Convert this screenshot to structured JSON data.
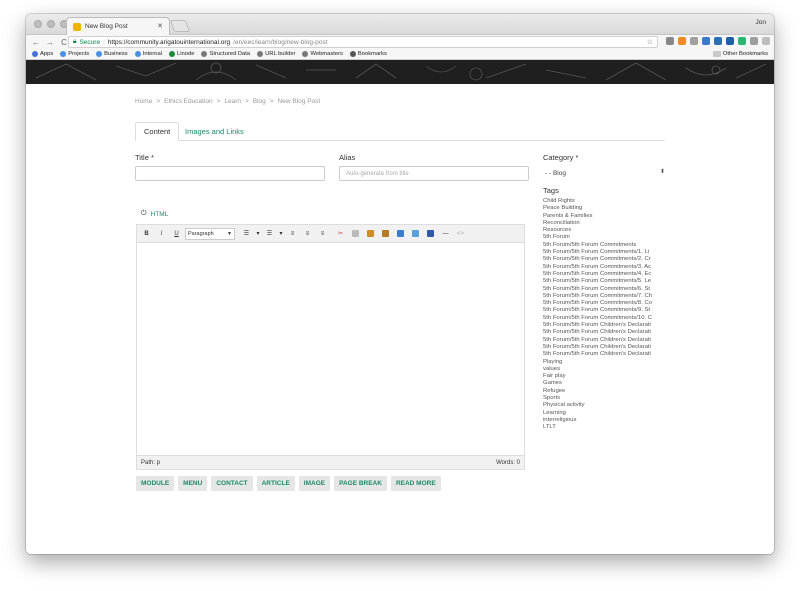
{
  "browser": {
    "tab_title": "New Blog Post",
    "user": "Jon",
    "url_secure": "Secure",
    "url_host": "https://community.arigatouinternational.org",
    "url_path": "/en/eec/learn/blog/new-blog-post",
    "bookmarks": [
      {
        "label": "Apps",
        "color": "#4a6fd8"
      },
      {
        "label": "Projects",
        "color": "#4a90e2"
      },
      {
        "label": "Business",
        "color": "#4a90e2"
      },
      {
        "label": "Internal",
        "color": "#4a90e2"
      },
      {
        "label": "Linode",
        "color": "#1b8a3a"
      },
      {
        "label": "Structured Data",
        "color": "#777777"
      },
      {
        "label": "URL builder",
        "color": "#777777"
      },
      {
        "label": "Webmasters",
        "color": "#777777"
      },
      {
        "label": "Bookmarks",
        "color": "#555555"
      }
    ],
    "other_bookmarks": "Other Bookmarks"
  },
  "breadcrumb": [
    "Home",
    ">",
    "Ethics Education",
    ">",
    "Learn",
    ">",
    "Blog",
    ">",
    "New Blog Post"
  ],
  "tabs": {
    "content": "Content",
    "images": "Images and Links"
  },
  "form": {
    "title_label": "Title *",
    "title_value": "",
    "alias_label": "Alias",
    "alias_placeholder": "Auto-generate from title",
    "category_label": "Category *",
    "category_value": "- - Blog",
    "html_toggle": "HTML"
  },
  "editor": {
    "format_value": "Paragraph",
    "path": "Path: p",
    "words": "Words: 0"
  },
  "buttons": {
    "module": "MODULE",
    "menu": "MENU",
    "contact": "CONTACT",
    "article": "ARTICLE",
    "image": "IMAGE",
    "page_break": "PAGE BREAK",
    "read_more": "READ MORE"
  },
  "tags_title": "Tags",
  "tags": [
    "Child Rights",
    "Peace Building",
    "Parents & Families",
    "Reconciliation",
    "Resources",
    "5th Forum",
    "5th Forum/5th Forum Commitments",
    "5th Forum/5th Forum Commitments/1. Li",
    "5th Forum/5th Forum Commitments/2. Cr",
    "5th Forum/5th Forum Commitments/3. Ac",
    "5th Forum/5th Forum Commitments/4. Ec",
    "5th Forum/5th Forum Commitments/5. Le",
    "5th Forum/5th Forum Commitments/6. St",
    "5th Forum/5th Forum Commitments/7. Ch",
    "5th Forum/5th Forum Commitments/8. Co",
    "5th Forum/5th Forum Commitments/9. St",
    "5th Forum/5th Forum Commitments/10. C",
    "5th Forum/5th Forum Children's Declarati",
    "5th Forum/5th Forum Children's Declarati",
    "5th Forum/5th Forum Children's Declarati",
    "5th Forum/5th Forum Children's Declarati",
    "5th Forum/5th Forum Children's Declarati",
    "Playing",
    "values",
    "Fair play",
    "Games",
    "Refugee",
    "Sports",
    "Physical activity",
    "Learning",
    "interreligious",
    "LTLT"
  ]
}
